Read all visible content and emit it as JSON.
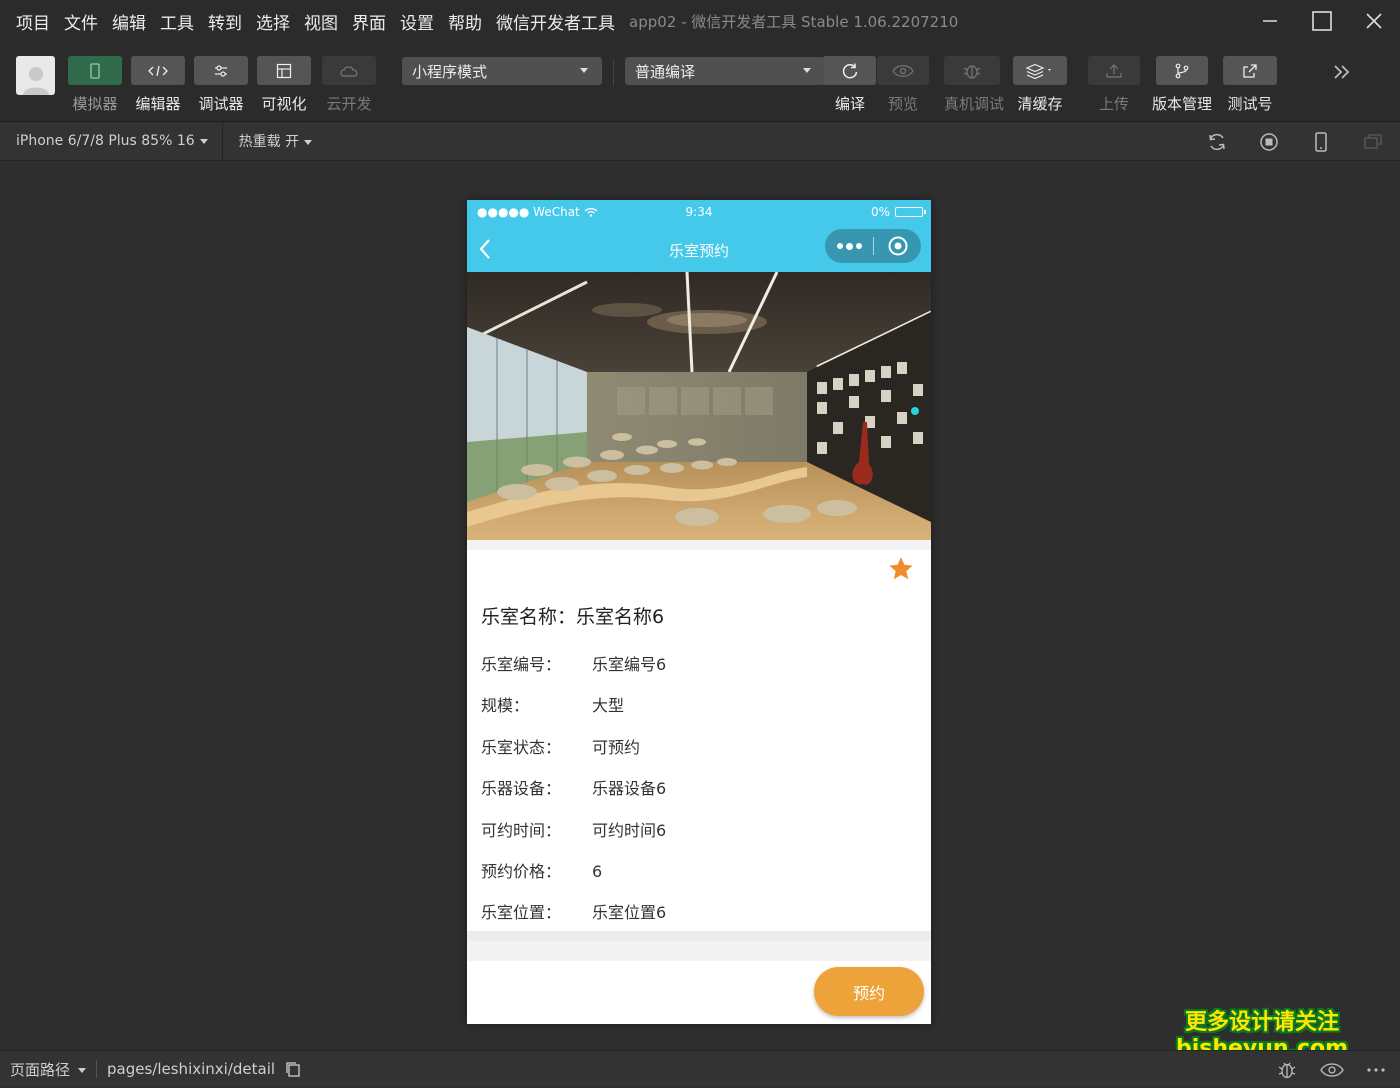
{
  "menubar": {
    "items": [
      "项目",
      "文件",
      "编辑",
      "工具",
      "转到",
      "选择",
      "视图",
      "界面",
      "设置",
      "帮助",
      "微信开发者工具"
    ],
    "window_title": "app02 - 微信开发者工具 Stable 1.06.2207210"
  },
  "toolbar": {
    "buttons": [
      {
        "label": "模拟器",
        "icon": "phone-icon",
        "state": "active"
      },
      {
        "label": "编辑器",
        "icon": "code-icon",
        "state": "normal"
      },
      {
        "label": "调试器",
        "icon": "debugger-icon",
        "state": "normal"
      },
      {
        "label": "可视化",
        "icon": "layout-icon",
        "state": "normal"
      },
      {
        "label": "云开发",
        "icon": "cloud-icon",
        "state": "disabled"
      }
    ],
    "mode_select": "小程序模式",
    "compile_select": "普通编译",
    "actions": [
      {
        "label": "编译",
        "icon": "refresh-icon",
        "state": "normal"
      },
      {
        "label": "预览",
        "icon": "eye-icon",
        "state": "disabled"
      },
      {
        "label": "真机调试",
        "icon": "bug-icon",
        "state": "disabled"
      },
      {
        "label": "清缓存",
        "icon": "layers-icon",
        "state": "normal"
      },
      {
        "label": "上传",
        "icon": "upload-icon",
        "state": "disabled"
      },
      {
        "label": "版本管理",
        "icon": "branch-icon",
        "state": "normal"
      },
      {
        "label": "测试号",
        "icon": "external-link-icon",
        "state": "normal"
      }
    ]
  },
  "subbar": {
    "device": "iPhone 6/7/8 Plus 85% 16",
    "hot_reload": "热重载 开"
  },
  "phone": {
    "status": {
      "carrier": "●●●●● WeChat",
      "time": "9:34",
      "battery": "0%"
    },
    "nav_title": "乐室预约",
    "room_title": "乐室名称：乐室名称6",
    "details": [
      {
        "key": "乐室编号：",
        "value": "乐室编号6"
      },
      {
        "key": "规模：",
        "value": "大型"
      },
      {
        "key": "乐室状态：",
        "value": "可预约"
      },
      {
        "key": "乐器设备：",
        "value": "乐器设备6"
      },
      {
        "key": "可约时间：",
        "value": "可约时间6"
      },
      {
        "key": "预约价格：",
        "value": "6"
      },
      {
        "key": "乐室位置：",
        "value": "乐室位置6"
      }
    ],
    "book_button": "预约"
  },
  "bottombar": {
    "path_label": "页面路径",
    "path": "pages/leshixinxi/detail"
  },
  "watermark": {
    "line1": "更多设计请关注",
    "line2": "bisheyun.com"
  },
  "colors": {
    "nav": "#44c9ea",
    "accent": "#eea23a",
    "star": "#f08c2a",
    "active_green": "#2f6b4a"
  }
}
